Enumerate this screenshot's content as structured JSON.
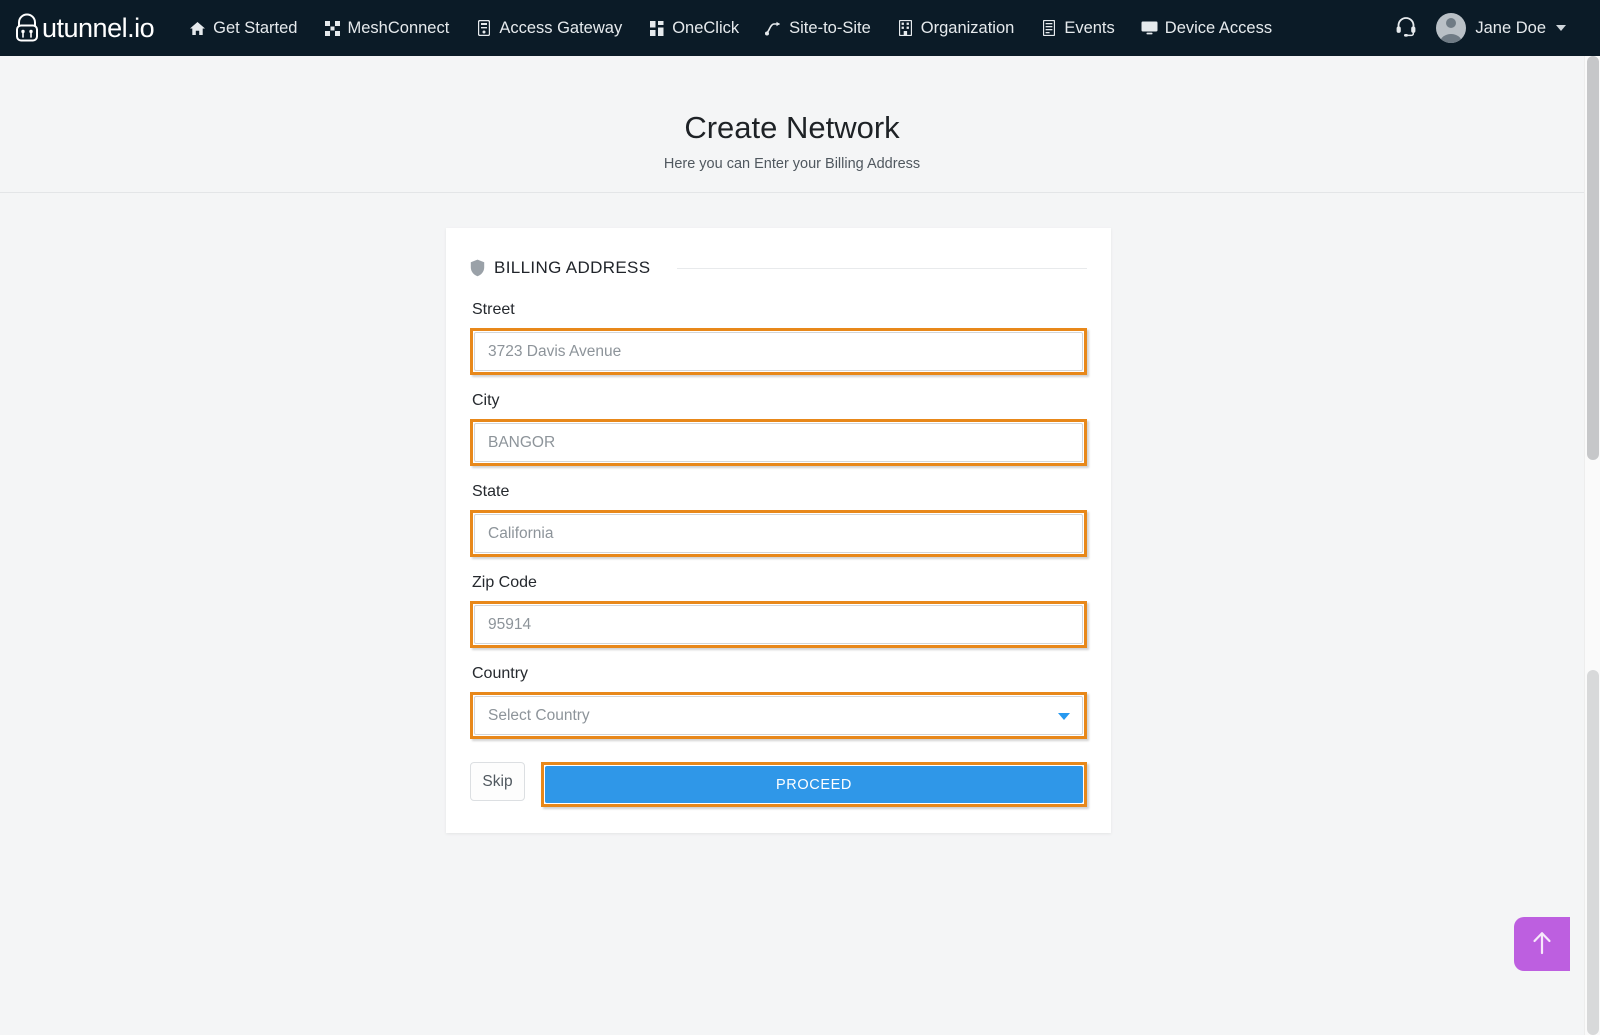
{
  "navbar": {
    "brand": {
      "text": "utunnel.io",
      "icon": "padlock-icon"
    },
    "items": [
      {
        "label": "Get Started",
        "icon": "home-icon"
      },
      {
        "label": "MeshConnect",
        "icon": "mesh-icon"
      },
      {
        "label": "Access Gateway",
        "icon": "gateway-icon"
      },
      {
        "label": "OneClick",
        "icon": "oneclick-icon"
      },
      {
        "label": "Site-to-Site",
        "icon": "site-to-site-icon"
      },
      {
        "label": "Organization",
        "icon": "building-icon"
      },
      {
        "label": "Events",
        "icon": "events-icon"
      },
      {
        "label": "Device Access",
        "icon": "monitor-icon"
      }
    ],
    "support_icon": "headset-icon",
    "user": {
      "name": "Jane Doe",
      "avatar": "user-avatar",
      "caret": "chevron-down-icon"
    },
    "background_color": "#0b1b27"
  },
  "header": {
    "title": "Create Network",
    "subtitle": "Here you can Enter your Billing Address"
  },
  "card": {
    "section_icon": "shield-icon",
    "section_title": "BILLING ADDRESS",
    "fields": [
      {
        "label": "Street",
        "placeholder": "3723 Davis Avenue",
        "value": ""
      },
      {
        "label": "City",
        "placeholder": "BANGOR",
        "value": ""
      },
      {
        "label": "State",
        "placeholder": "California",
        "value": ""
      },
      {
        "label": "Zip Code",
        "placeholder": "95914",
        "value": ""
      }
    ],
    "country": {
      "label": "Country",
      "selected": "Select Country",
      "caret_icon": "chevron-down-icon",
      "caret_color": "#2699f0"
    },
    "skip_label": "Skip",
    "proceed_label": "PROCEED"
  },
  "scroll_top": {
    "icon": "arrow-up-icon",
    "color": "#bd5fe0"
  },
  "highlight_color": "#e8881a",
  "accent_color": "#2f97e8"
}
